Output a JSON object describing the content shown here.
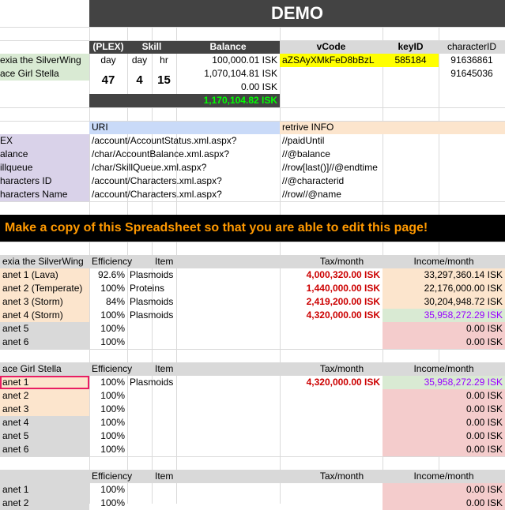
{
  "title": "DEMO",
  "header_row": {
    "plex": "(PLEX)",
    "skill": "Skill",
    "balance": "Balance",
    "vcode": "vCode",
    "keyid": "keyID",
    "charid": "characterID"
  },
  "time_units": {
    "day1": "day",
    "day2": "day",
    "hr": "hr"
  },
  "time_values": {
    "d1": "47",
    "d2": "4",
    "h": "15"
  },
  "characters": [
    "exia the SilverWing",
    "ace Girl Stella"
  ],
  "balances": [
    "100,000.01 ISK",
    "1,070,104.81 ISK",
    "0.00 ISK"
  ],
  "balance_total": "1,170,104.82 ISK",
  "vcode_value": "aZSAyXMkFeD8bBzL",
  "keyid_value": "585184",
  "character_ids": [
    "91636861",
    "91645036"
  ],
  "uri_header": "URI",
  "retrieve_header": "retrive INFO",
  "uri_rows": [
    {
      "label": "EX",
      "uri": "/account/AccountStatus.xml.aspx?",
      "info": "//paidUntil"
    },
    {
      "label": "alance",
      "uri": "/char/AccountBalance.xml.aspx?",
      "info": "//@balance"
    },
    {
      "label": "illqueue",
      "uri": "/char/SkillQueue.xml.aspx?",
      "info": "//row[last()]//@endtime"
    },
    {
      "label": "haracters ID",
      "uri": "/account/Characters.xml.aspx?",
      "info": "//@characterid"
    },
    {
      "label": "haracters Name",
      "uri": "/account/Characters.xml.aspx?",
      "info": "//row//@name"
    }
  ],
  "banner": "Make a copy of this Spreadsheet so that you are able to edit this page!",
  "table_headers": {
    "efficiency": "Efficiency",
    "item": "Item",
    "tax": "Tax/month",
    "income": "Income/month"
  },
  "section1": {
    "name": "exia the SilverWing",
    "rows": [
      {
        "planet": "anet 1 (Lava)",
        "eff": "92.6%",
        "item": "Plasmoids",
        "tax": "4,000,320.00 ISK",
        "income": "33,297,360.14 ISK",
        "style": "orange"
      },
      {
        "planet": "anet 2 (Temperate)",
        "eff": "100%",
        "item": "Proteins",
        "tax": "1,440,000.00 ISK",
        "income": "22,176,000.00 ISK",
        "style": "orange"
      },
      {
        "planet": "anet 3 (Storm)",
        "eff": "84%",
        "item": "Plasmoids",
        "tax": "2,419,200.00 ISK",
        "income": "30,204,948.72 ISK",
        "style": "orange"
      },
      {
        "planet": "anet 4 (Storm)",
        "eff": "100%",
        "item": "Plasmoids",
        "tax": "4,320,000.00 ISK",
        "income": "35,958,272.29 ISK",
        "style": "green"
      },
      {
        "planet": "anet 5",
        "eff": "100%",
        "item": "",
        "tax": "",
        "income": "0.00 ISK",
        "style": "red"
      },
      {
        "planet": "anet 6",
        "eff": "100%",
        "item": "",
        "tax": "",
        "income": "0.00 ISK",
        "style": "red"
      }
    ]
  },
  "section2": {
    "name": "ace Girl Stella",
    "rows": [
      {
        "planet": "anet 1",
        "eff": "100%",
        "item": "Plasmoids",
        "tax": "4,320,000.00 ISK",
        "income": "35,958,272.29 ISK",
        "style": "green"
      },
      {
        "planet": "anet 2",
        "eff": "100%",
        "item": "",
        "tax": "",
        "income": "0.00 ISK",
        "style": "red"
      },
      {
        "planet": "anet 3",
        "eff": "100%",
        "item": "",
        "tax": "",
        "income": "0.00 ISK",
        "style": "red"
      },
      {
        "planet": "anet 4",
        "eff": "100%",
        "item": "",
        "tax": "",
        "income": "0.00 ISK",
        "style": "red"
      },
      {
        "planet": "anet 5",
        "eff": "100%",
        "item": "",
        "tax": "",
        "income": "0.00 ISK",
        "style": "red"
      },
      {
        "planet": "anet 6",
        "eff": "100%",
        "item": "",
        "tax": "",
        "income": "0.00 ISK",
        "style": "red"
      }
    ]
  },
  "section3": {
    "name": "",
    "rows": [
      {
        "planet": "anet 1",
        "eff": "100%",
        "item": "",
        "tax": "",
        "income": "0.00 ISK",
        "style": "red"
      },
      {
        "planet": "anet 2",
        "eff": "100%",
        "item": "",
        "tax": "",
        "income": "0.00 ISK",
        "style": "red"
      }
    ]
  },
  "colors": {
    "dark": "#434343",
    "lavender": "#d9d2e9",
    "lightgreen": "#d9ead3",
    "yellow": "#ffff00",
    "peach": "#fce5cd",
    "blueish": "#c9daf8",
    "orange_text": "#ff9900",
    "green_text": "#00ff00",
    "red_text": "#cc0000",
    "purple_text": "#9900ff",
    "red_fill": "#f4cccc",
    "green_fill": "#d9ead3",
    "orange_fill": "#fce5cd",
    "gray": "#d9d9d9",
    "header_bg": "#999999"
  }
}
